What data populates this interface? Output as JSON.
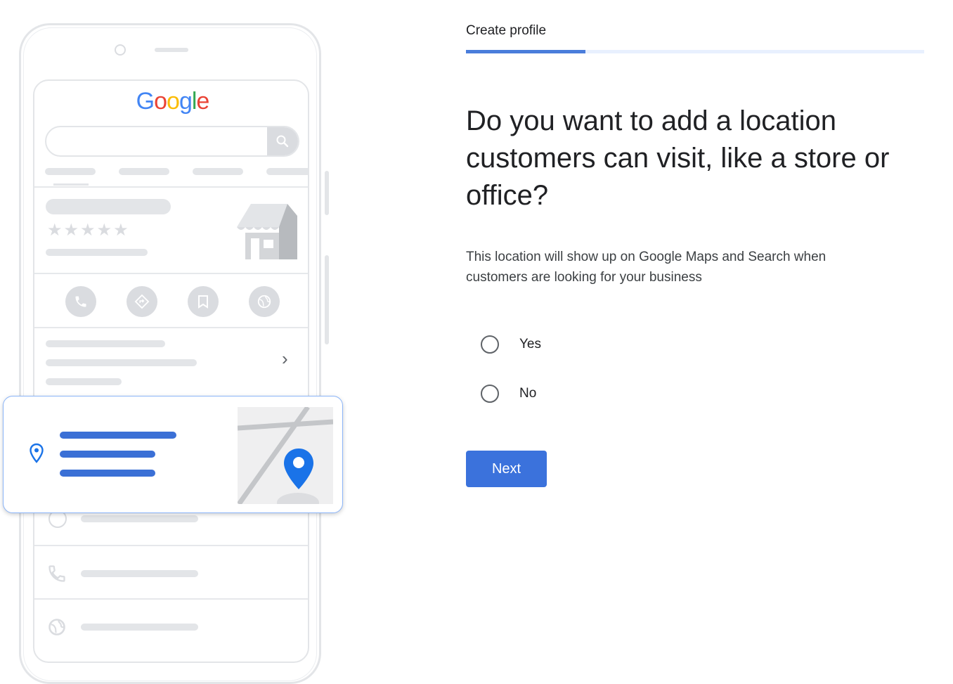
{
  "illustration": {
    "logo_text": "Google",
    "logo_colors": [
      "#4285F4",
      "#EA4335",
      "#FBBC05",
      "#4285F4",
      "#34A853",
      "#EA4335"
    ],
    "rating_stars": "★★★★★",
    "chevron": "›"
  },
  "stepper": {
    "tab_label": "Create profile",
    "progress": 0.26
  },
  "question": {
    "title": "Do you want to add a location customers can visit, like a store or office?",
    "description": "This location will show up on Google Maps and Search when customers are looking for your business",
    "options": [
      {
        "label": "Yes",
        "selected": false
      },
      {
        "label": "No",
        "selected": false
      }
    ]
  },
  "actions": {
    "next_label": "Next"
  },
  "colors": {
    "accent": "#3b72dc",
    "progress_track": "#e8f0fe",
    "pin": "#1a73e8"
  }
}
